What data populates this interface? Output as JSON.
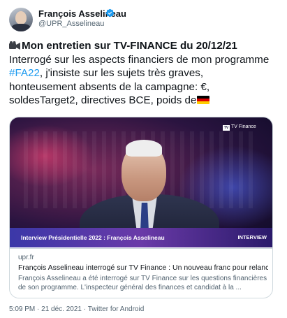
{
  "author": {
    "name": "François Asselineau",
    "handle": "@UPR_Asselineau"
  },
  "tweet": {
    "title": "Mon entretien sur TV-FINANCE du 20/12/21",
    "line2": "Interrogé sur les aspects financiers de mon programme",
    "hashtag": "#FA22",
    "line3_rest": ", j'insiste sur les sujets très graves,",
    "line4": "honteusement absents de la campagne: €,",
    "line5": "soldesTarget2, directives BCE, poids de"
  },
  "card": {
    "channel_logo": "TV Finance",
    "lower_third_title": "Interview Présidentielle 2022 : François Asselineau",
    "lower_third_tag": "INTERVIEW",
    "domain": "upr.fr",
    "title": "François Asselineau interrogé sur TV Finance : Un nouveau franc pour relancer...",
    "desc_line1": "François Asselineau a été interrogé sur TV Finance sur les questions financières",
    "desc_line2": "de son programme. L'inspecteur général des finances et candidat à la ..."
  },
  "meta": {
    "time": "5:09 PM",
    "sep": " · ",
    "date": "21 déc. 2021",
    "app": "Twitter for Android"
  },
  "colors": {
    "link": "#1d9bf0",
    "text": "#0f1419",
    "secondary": "#536471",
    "border": "#cfd9de",
    "flag_black": "#000000",
    "flag_red": "#dd0000",
    "flag_gold": "#ffce00"
  },
  "icons": [
    "verified-badge-icon",
    "movie-camera-icon",
    "german-flag-icon"
  ]
}
